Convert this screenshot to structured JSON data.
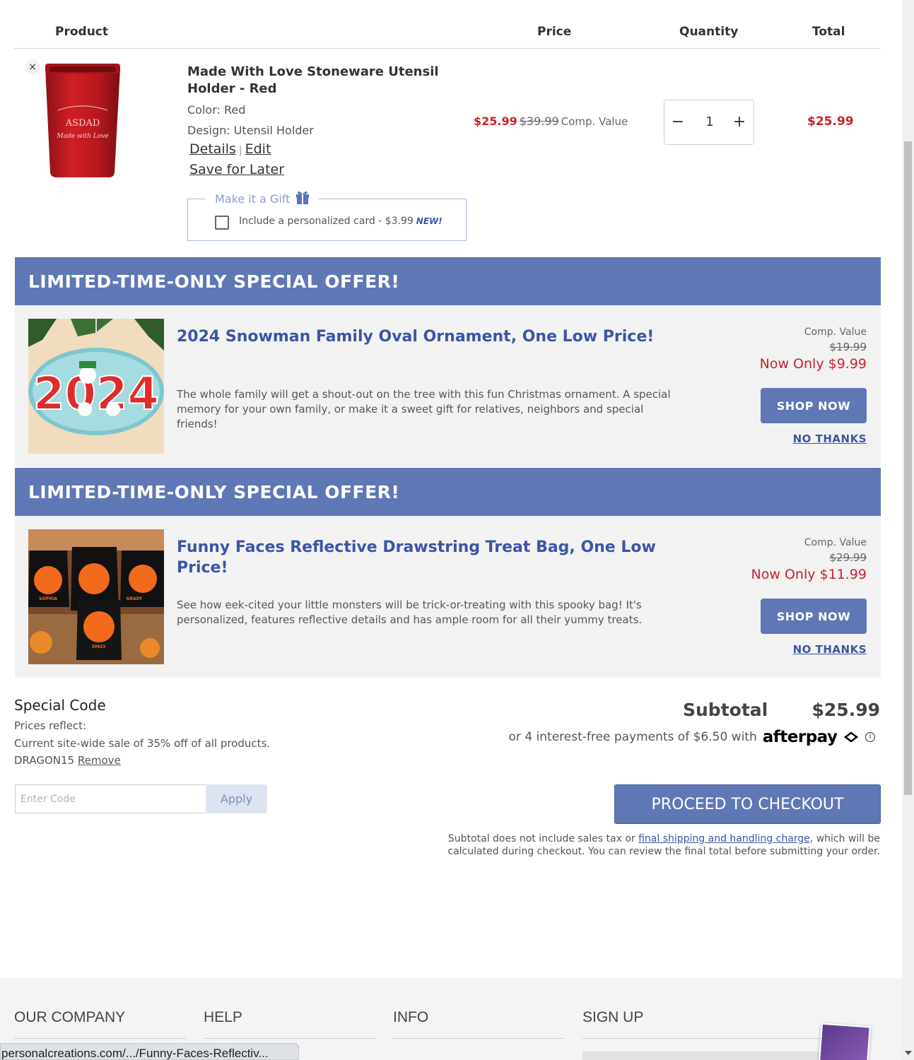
{
  "cart_header": {
    "product": "Product",
    "price": "Price",
    "quantity": "Quantity",
    "total": "Total"
  },
  "item": {
    "remove": "×",
    "name": "Made With Love Stoneware Utensil Holder - Red",
    "color": "Color: Red",
    "design": "Design: Utensil Holder",
    "details_link": "Details",
    "separator": "|",
    "edit_link": "Edit",
    "save_for_later": "Save for Later",
    "gift_legend": "Make it a Gift",
    "gift_option": "Include a personalized card - $3.99",
    "gift_new_badge": "NEW!",
    "product_print_1": "ASDAD",
    "product_print_2": "Made with Love",
    "price_now": "$25.99",
    "price_was": "$39.99",
    "price_comp": "Comp. Value",
    "qty_minus": "−",
    "qty_value": "1",
    "qty_plus": "+",
    "total": "$25.99"
  },
  "offers": [
    {
      "heading": "LIMITED-TIME-ONLY SPECIAL OFFER!",
      "title": "2024 Snowman Family Oval Ornament, One Low Price!",
      "description": "The whole family will get a shout-out on the tree with this fun Christmas ornament. A special memory for your own family, or make it a sweet gift for relatives, neighbors and special friends!",
      "comp_label": "Comp. Value",
      "comp_price": "$19.99",
      "now_only": "Now Only $9.99",
      "shop_now": "SHOP NOW",
      "no_thanks": "NO THANKS",
      "image_text": "2024"
    },
    {
      "heading": "LIMITED-TIME-ONLY SPECIAL OFFER!",
      "title": "Funny Faces Reflective Drawstring Treat Bag, One Low Price!",
      "description": "See how eek-cited your little monsters will be trick-or-treating with this spooky bag! It's personalized, features reflective details and has ample room for all their yummy treats.",
      "comp_label": "Comp. Value",
      "comp_price": "$29.99",
      "now_only": "Now Only $11.99",
      "shop_now": "SHOP NOW",
      "no_thanks": "NO THANKS",
      "image_names": [
        "SOPHIA",
        "GRADY",
        "EMILY"
      ]
    }
  ],
  "special_code": {
    "title": "Special Code",
    "prices_reflect": "Prices reflect:",
    "sale_note": "Current site-wide sale of 35% off of all products.",
    "code": "DRAGON15",
    "remove": "Remove",
    "placeholder": "Enter Code",
    "apply": "Apply"
  },
  "summary": {
    "subtotal_label": "Subtotal",
    "subtotal_value": "$25.99",
    "afterpay_text": "or 4 interest-free payments of $6.50 with",
    "afterpay_brand": "afterpay",
    "info": "i",
    "checkout": "PROCEED TO CHECKOUT",
    "disclaimer_pre": "Subtotal does not include sales tax or",
    "disclaimer_link": "final shipping and handling charge",
    "disclaimer_post": ", which will be calculated during checkout. You can review the final total before submitting your order."
  },
  "footer": {
    "company": "OUR COMPANY",
    "help": "HELP",
    "info": "INFO",
    "signup": "SIGN UP"
  },
  "status_bar": {
    "url": "personalcreations.com/.../Funny-Faces-Reflectiv..."
  },
  "colors": {
    "accent": "#6077b6",
    "price_red": "#c8232c",
    "link_blue": "#3c55a5",
    "offer_bg": "#f2f2f2"
  }
}
